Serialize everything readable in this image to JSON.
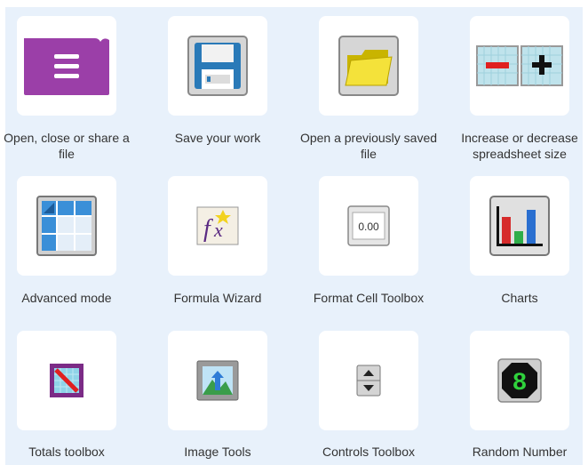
{
  "tools": [
    {
      "label": "Open, close or share a file",
      "icon": "menu-file-icon"
    },
    {
      "label": "Save your work",
      "icon": "floppy-disk-icon"
    },
    {
      "label": "Open a previously saved file",
      "icon": "folder-icon"
    },
    {
      "label": "Increase or decrease spreadsheet size",
      "icon": "resize-grid-icon"
    },
    {
      "label": "Advanced mode",
      "icon": "spreadsheet-grid-icon"
    },
    {
      "label": "Formula Wizard",
      "icon": "formula-fx-icon"
    },
    {
      "label": "Format Cell Toolbox",
      "icon": "format-cell-icon",
      "icon_text": "0.00"
    },
    {
      "label": "Charts",
      "icon": "bar-chart-icon"
    },
    {
      "label": "Totals toolbox",
      "icon": "totals-icon"
    },
    {
      "label": "Image Tools",
      "icon": "image-icon"
    },
    {
      "label": "Controls Toolbox",
      "icon": "spinner-control-icon"
    },
    {
      "label": "Random Number",
      "icon": "random-number-icon",
      "icon_text": "8"
    }
  ],
  "colors": {
    "panel_bg": "#e8f1fb",
    "tile_bg": "#ffffff",
    "purple": "#9b3fa8",
    "chart_red": "#d62b2b",
    "chart_green": "#2fae4a",
    "chart_blue": "#2a6fd0"
  }
}
